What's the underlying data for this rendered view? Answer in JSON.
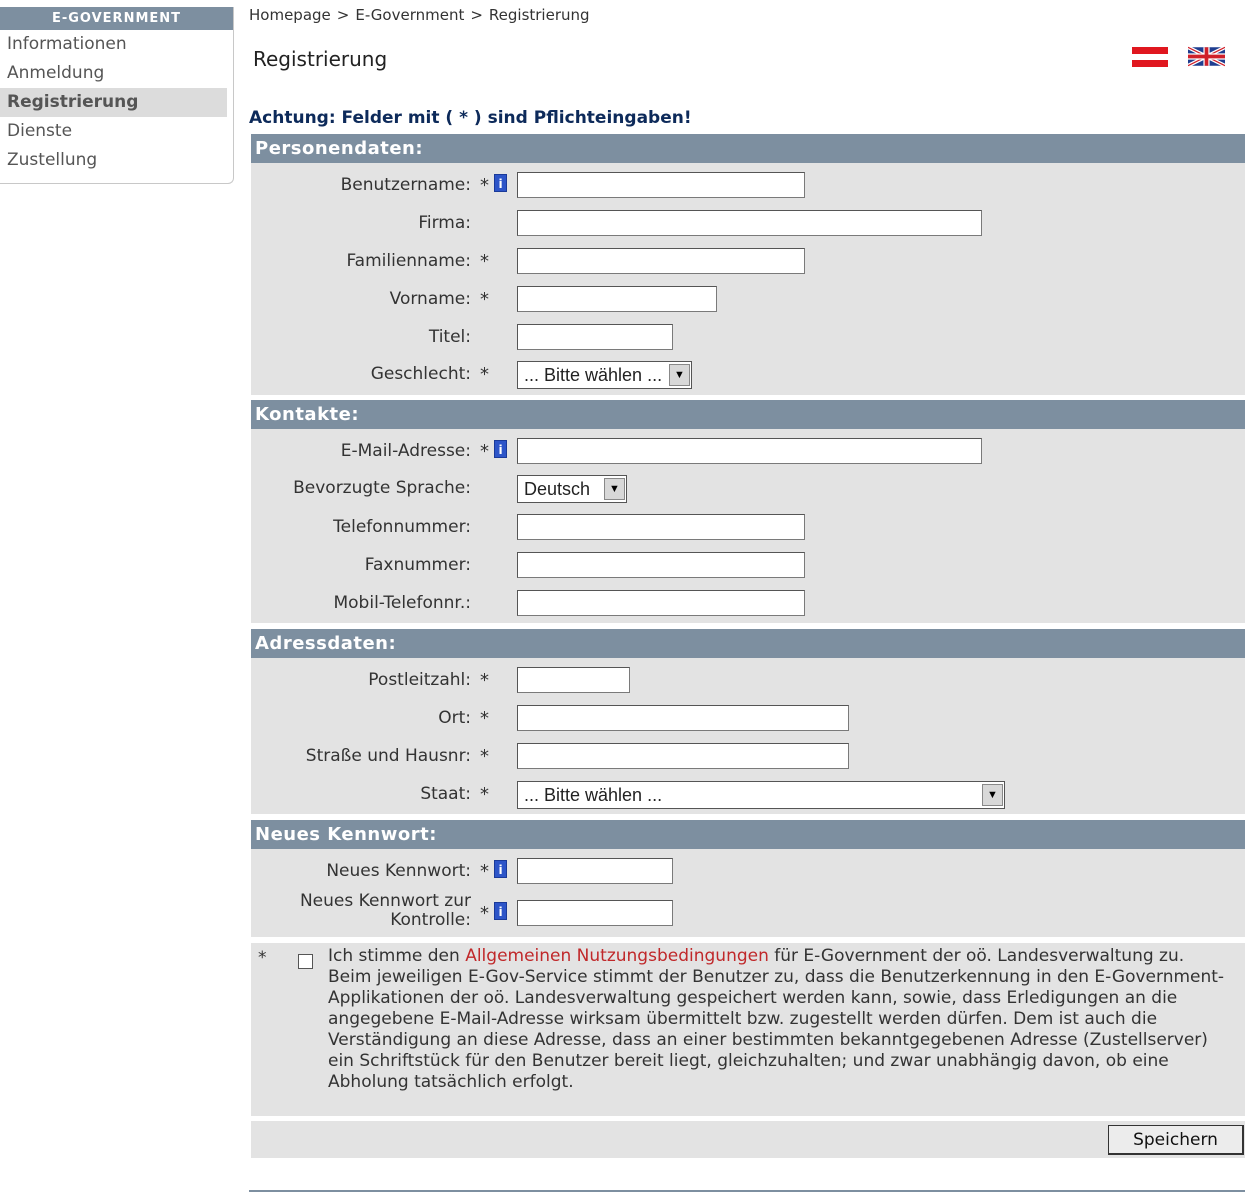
{
  "sidebar": {
    "header": "E-GOVERNMENT",
    "items": [
      {
        "label": "Informationen"
      },
      {
        "label": "Anmeldung"
      },
      {
        "label": "Registrierung"
      },
      {
        "label": "Dienste"
      },
      {
        "label": "Zustellung"
      }
    ]
  },
  "breadcrumb": {
    "items": [
      "Homepage",
      "E-Government",
      "Registrierung"
    ],
    "separator": ">"
  },
  "page": {
    "title": "Registrierung",
    "hint": "Achtung: Felder mit ( * ) sind Pflichteingaben!",
    "required_marker": "*",
    "info_icon_glyph": "i"
  },
  "sections": {
    "personal": {
      "title": "Personendaten:",
      "fields": [
        {
          "label": "Benutzername:",
          "value": ""
        },
        {
          "label": "Firma:",
          "value": ""
        },
        {
          "label": "Familienname:",
          "value": ""
        },
        {
          "label": "Vorname:",
          "value": ""
        },
        {
          "label": "Titel:",
          "value": ""
        },
        {
          "label": "Geschlecht:",
          "value": "... Bitte wählen ..."
        }
      ]
    },
    "contacts": {
      "title": "Kontakte:",
      "fields": [
        {
          "label": "E-Mail-Adresse:",
          "value": ""
        },
        {
          "label": "Bevorzugte Sprache:",
          "value": "Deutsch"
        },
        {
          "label": "Telefonnummer:",
          "value": ""
        },
        {
          "label": "Faxnummer:",
          "value": ""
        },
        {
          "label": "Mobil-Telefonnr.:",
          "value": ""
        }
      ]
    },
    "address": {
      "title": "Adressdaten:",
      "fields": [
        {
          "label": "Postleitzahl:",
          "value": ""
        },
        {
          "label": "Ort:",
          "value": ""
        },
        {
          "label": "Straße und Hausnr:",
          "value": ""
        },
        {
          "label": "Staat:",
          "value": "... Bitte wählen ..."
        }
      ]
    },
    "password": {
      "title": "Neues Kennwort:",
      "fields": [
        {
          "label": "Neues Kennwort:",
          "value": ""
        },
        {
          "label_line1": "Neues Kennwort zur",
          "label_line2": "Kontrolle:",
          "value": ""
        }
      ]
    }
  },
  "terms": {
    "checked": false,
    "text_before": "Ich stimme den ",
    "link": "Allgemeinen Nutzungsbedingungen",
    "text_after": " für E-Government der oö. Landesverwaltung zu.",
    "paragraph": "Beim jeweiligen E-Gov-Service stimmt der Benutzer zu, dass die Benutzerkennung in den E-Government-Applikationen der oö. Landesverwaltung gespeichert werden kann, sowie, dass Erledigungen an die angegebene E-Mail-Adresse wirksam übermittelt bzw. zugestellt werden dürfen. Dem ist auch die Verständigung an diese Adresse, dass an einer bestimmten bekanntgegebenen Adresse (Zustellserver) ein Schriftstück für den Benutzer bereit liegt, gleichzuhalten; und zwar unabhängig davon, ob eine Abholung tatsächlich erfolgt."
  },
  "actions": {
    "save_label": "Speichern"
  },
  "colors": {
    "section_header": "#7d8fa0",
    "section_bg": "#e3e3e3",
    "hint": "#0d2a5a",
    "link": "#c0282a"
  }
}
